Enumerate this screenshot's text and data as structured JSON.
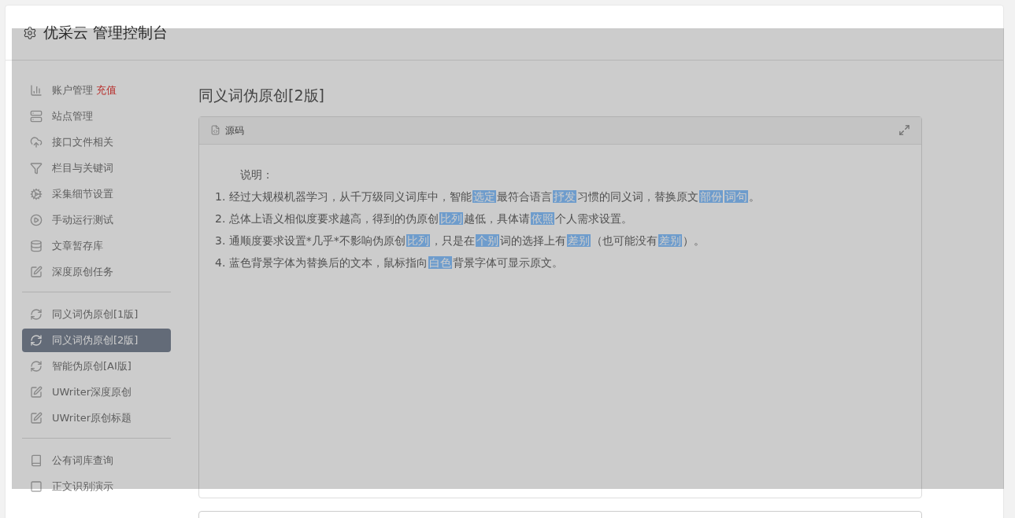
{
  "header": {
    "title": "优采云 管理控制台"
  },
  "sidebar": {
    "groups": [
      {
        "items": [
          {
            "label": "账户管理",
            "badge": "充值",
            "selected": false
          },
          {
            "label": "站点管理",
            "selected": false
          },
          {
            "label": "接口文件相关",
            "selected": false
          },
          {
            "label": "栏目与关键词",
            "selected": false
          },
          {
            "label": "采集细节设置",
            "selected": false
          },
          {
            "label": "手动运行测试",
            "selected": false
          },
          {
            "label": "文章暂存库",
            "selected": false
          },
          {
            "label": "深度原创任务",
            "selected": false
          }
        ]
      },
      {
        "items": [
          {
            "label": "同义词伪原创[1版]",
            "selected": false
          },
          {
            "label": "同义词伪原创[2版]",
            "selected": true
          },
          {
            "label": "智能伪原创[AI版]",
            "selected": false
          },
          {
            "label": "UWriter深度原创",
            "selected": false
          },
          {
            "label": "UWriter原创标题",
            "selected": false
          }
        ]
      },
      {
        "items": [
          {
            "label": "公有词库查询",
            "selected": false
          },
          {
            "label": "正文识别演示",
            "selected": false
          }
        ]
      }
    ]
  },
  "main": {
    "title": "同义词伪原创[2版]",
    "panel": {
      "tab": "源码",
      "heading": "说明：",
      "lines": [
        [
          {
            "text": "1. 经过大规模机器学习，从千万级同义词库中，智能",
            "replaced": false
          },
          {
            "text": "选定",
            "replaced": true
          },
          {
            "text": "最符合语言",
            "replaced": false
          },
          {
            "text": "抒发",
            "replaced": true
          },
          {
            "text": "习惯的同义词，替换原文",
            "replaced": false
          },
          {
            "text": "部份",
            "replaced": true
          },
          {
            "text": "词句",
            "replaced": true
          },
          {
            "text": "。",
            "replaced": false
          }
        ],
        [
          {
            "text": "2. 总体上语义相似度要求越高，得到的伪原创",
            "replaced": false
          },
          {
            "text": "比列",
            "replaced": true
          },
          {
            "text": "越低，具体请",
            "replaced": false
          },
          {
            "text": "依照",
            "replaced": true
          },
          {
            "text": "个人需求设置。",
            "replaced": false
          }
        ],
        [
          {
            "text": "3. 通顺度要求设置*几乎*不影响伪原创",
            "replaced": false
          },
          {
            "text": "比列",
            "replaced": true
          },
          {
            "text": "，只是在",
            "replaced": false
          },
          {
            "text": "个别",
            "replaced": true
          },
          {
            "text": "词的选择上有",
            "replaced": false
          },
          {
            "text": "差别",
            "replaced": true
          },
          {
            "text": "（也可能没有",
            "replaced": false
          },
          {
            "text": "差别",
            "replaced": true
          },
          {
            "text": "）。",
            "replaced": false
          }
        ],
        [
          {
            "text": "4. 蓝色背景字体为替换后的文本，鼠标指向",
            "replaced": false
          },
          {
            "text": "白色",
            "replaced": true
          },
          {
            "text": "背景字体可显示原文。",
            "replaced": false
          }
        ]
      ]
    }
  },
  "overlay": {
    "shown": true
  }
}
